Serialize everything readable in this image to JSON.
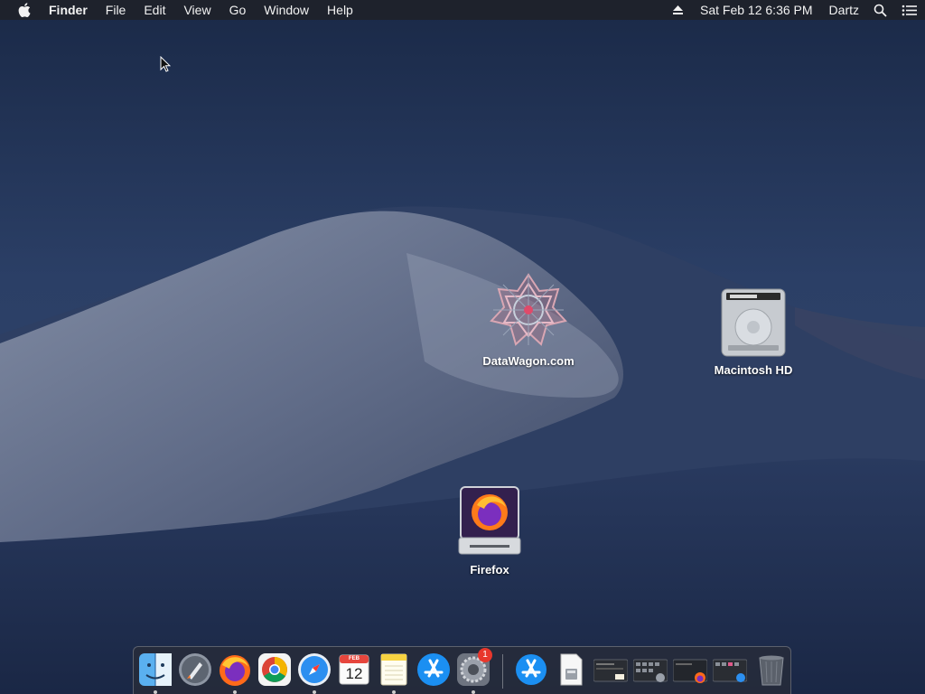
{
  "menubar": {
    "app_name": "Finder",
    "menus": [
      "File",
      "Edit",
      "View",
      "Go",
      "Window",
      "Help"
    ],
    "clock": "Sat Feb 12  6:36 PM",
    "user": "Dartz"
  },
  "desktop": {
    "icons": [
      {
        "label": "DataWagon.com",
        "icon": "datawagon-volume-icon"
      },
      {
        "label": "Macintosh HD",
        "icon": "hard-drive-icon"
      },
      {
        "label": "Firefox",
        "icon": "firefox-disk-image-icon"
      }
    ]
  },
  "dock": {
    "calendar_month": "FEB",
    "calendar_day": "12",
    "system_preferences_badge": "1",
    "items": [
      {
        "name": "Finder",
        "icon": "finder-icon",
        "running": true
      },
      {
        "name": "Launchpad",
        "icon": "launchpad-icon",
        "running": false
      },
      {
        "name": "Firefox",
        "icon": "firefox-icon",
        "running": true
      },
      {
        "name": "Google Chrome",
        "icon": "chrome-icon",
        "running": false
      },
      {
        "name": "Safari",
        "icon": "safari-icon",
        "running": true
      },
      {
        "name": "Calendar",
        "icon": "calendar-icon",
        "running": false
      },
      {
        "name": "Notes",
        "icon": "notes-icon",
        "running": true
      },
      {
        "name": "App Store",
        "icon": "app-store-icon",
        "running": false
      },
      {
        "name": "System Preferences",
        "icon": "system-preferences-icon",
        "running": true
      },
      {
        "name": "App Store Downloads",
        "icon": "app-store-folder-icon",
        "running": false
      },
      {
        "name": "Document",
        "icon": "document-icon",
        "running": false
      },
      {
        "name": "Window 1",
        "icon": "minimized-window-icon",
        "running": false
      },
      {
        "name": "Window 2",
        "icon": "minimized-window-icon",
        "running": false
      },
      {
        "name": "Window 3",
        "icon": "minimized-window-icon",
        "running": false
      },
      {
        "name": "Window 4",
        "icon": "minimized-window-icon",
        "running": false
      },
      {
        "name": "Trash",
        "icon": "trash-icon",
        "running": false
      }
    ]
  }
}
